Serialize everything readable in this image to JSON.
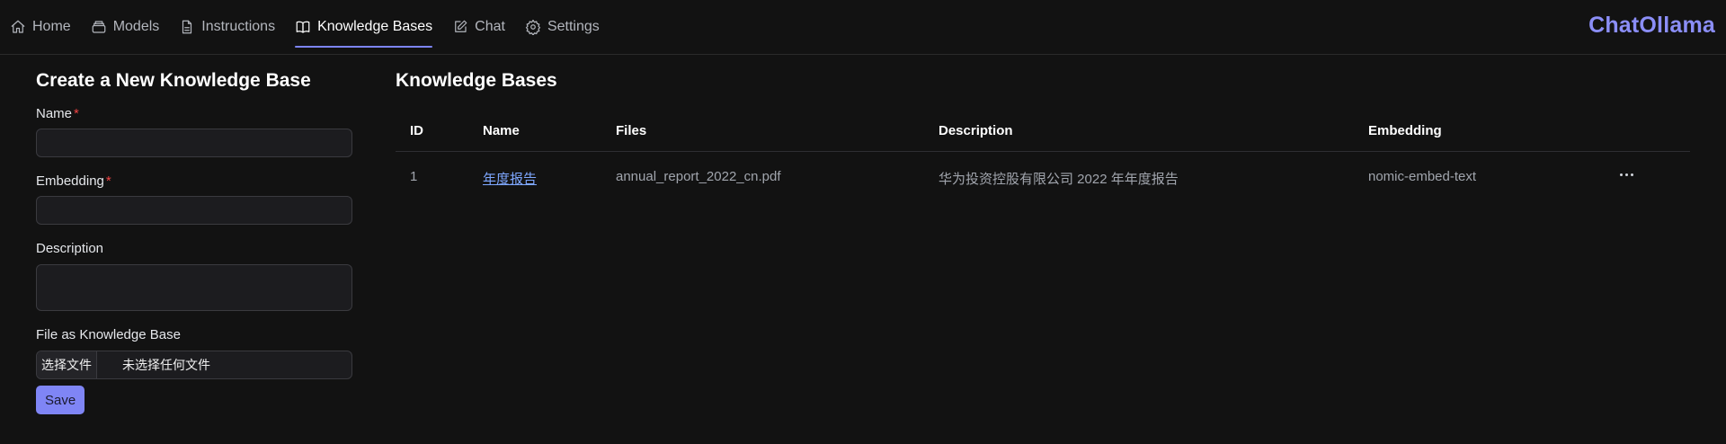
{
  "nav": {
    "items": [
      {
        "label": "Home",
        "icon": "home-icon"
      },
      {
        "label": "Models",
        "icon": "models-icon"
      },
      {
        "label": "Instructions",
        "icon": "document-icon"
      },
      {
        "label": "Knowledge Bases",
        "icon": "book-icon",
        "active": true
      },
      {
        "label": "Chat",
        "icon": "edit-icon"
      },
      {
        "label": "Settings",
        "icon": "gear-icon"
      }
    ],
    "brand": "ChatOllama"
  },
  "form": {
    "title": "Create a New Knowledge Base",
    "name_label": "Name",
    "name_value": "",
    "embedding_label": "Embedding",
    "embedding_value": "",
    "required_mark": "*",
    "description_label": "Description",
    "description_value": "",
    "file_label": "File as Knowledge Base",
    "file_button": "选择文件",
    "file_status": "未选择任何文件",
    "save_label": "Save"
  },
  "knowledge_bases": {
    "title": "Knowledge Bases",
    "columns": [
      "ID",
      "Name",
      "Files",
      "Description",
      "Embedding"
    ],
    "rows": [
      {
        "id": "1",
        "name": "年度报告",
        "files": "annual_report_2022_cn.pdf",
        "description": "华为投资控股有限公司 2022 年年度报告",
        "embedding": "nomic-embed-text"
      }
    ]
  },
  "colors": {
    "background": "#121212",
    "accent": "#7f85f5",
    "brand": "#8b8ef7",
    "link": "#7ea7ff",
    "required": "#ef4444"
  }
}
